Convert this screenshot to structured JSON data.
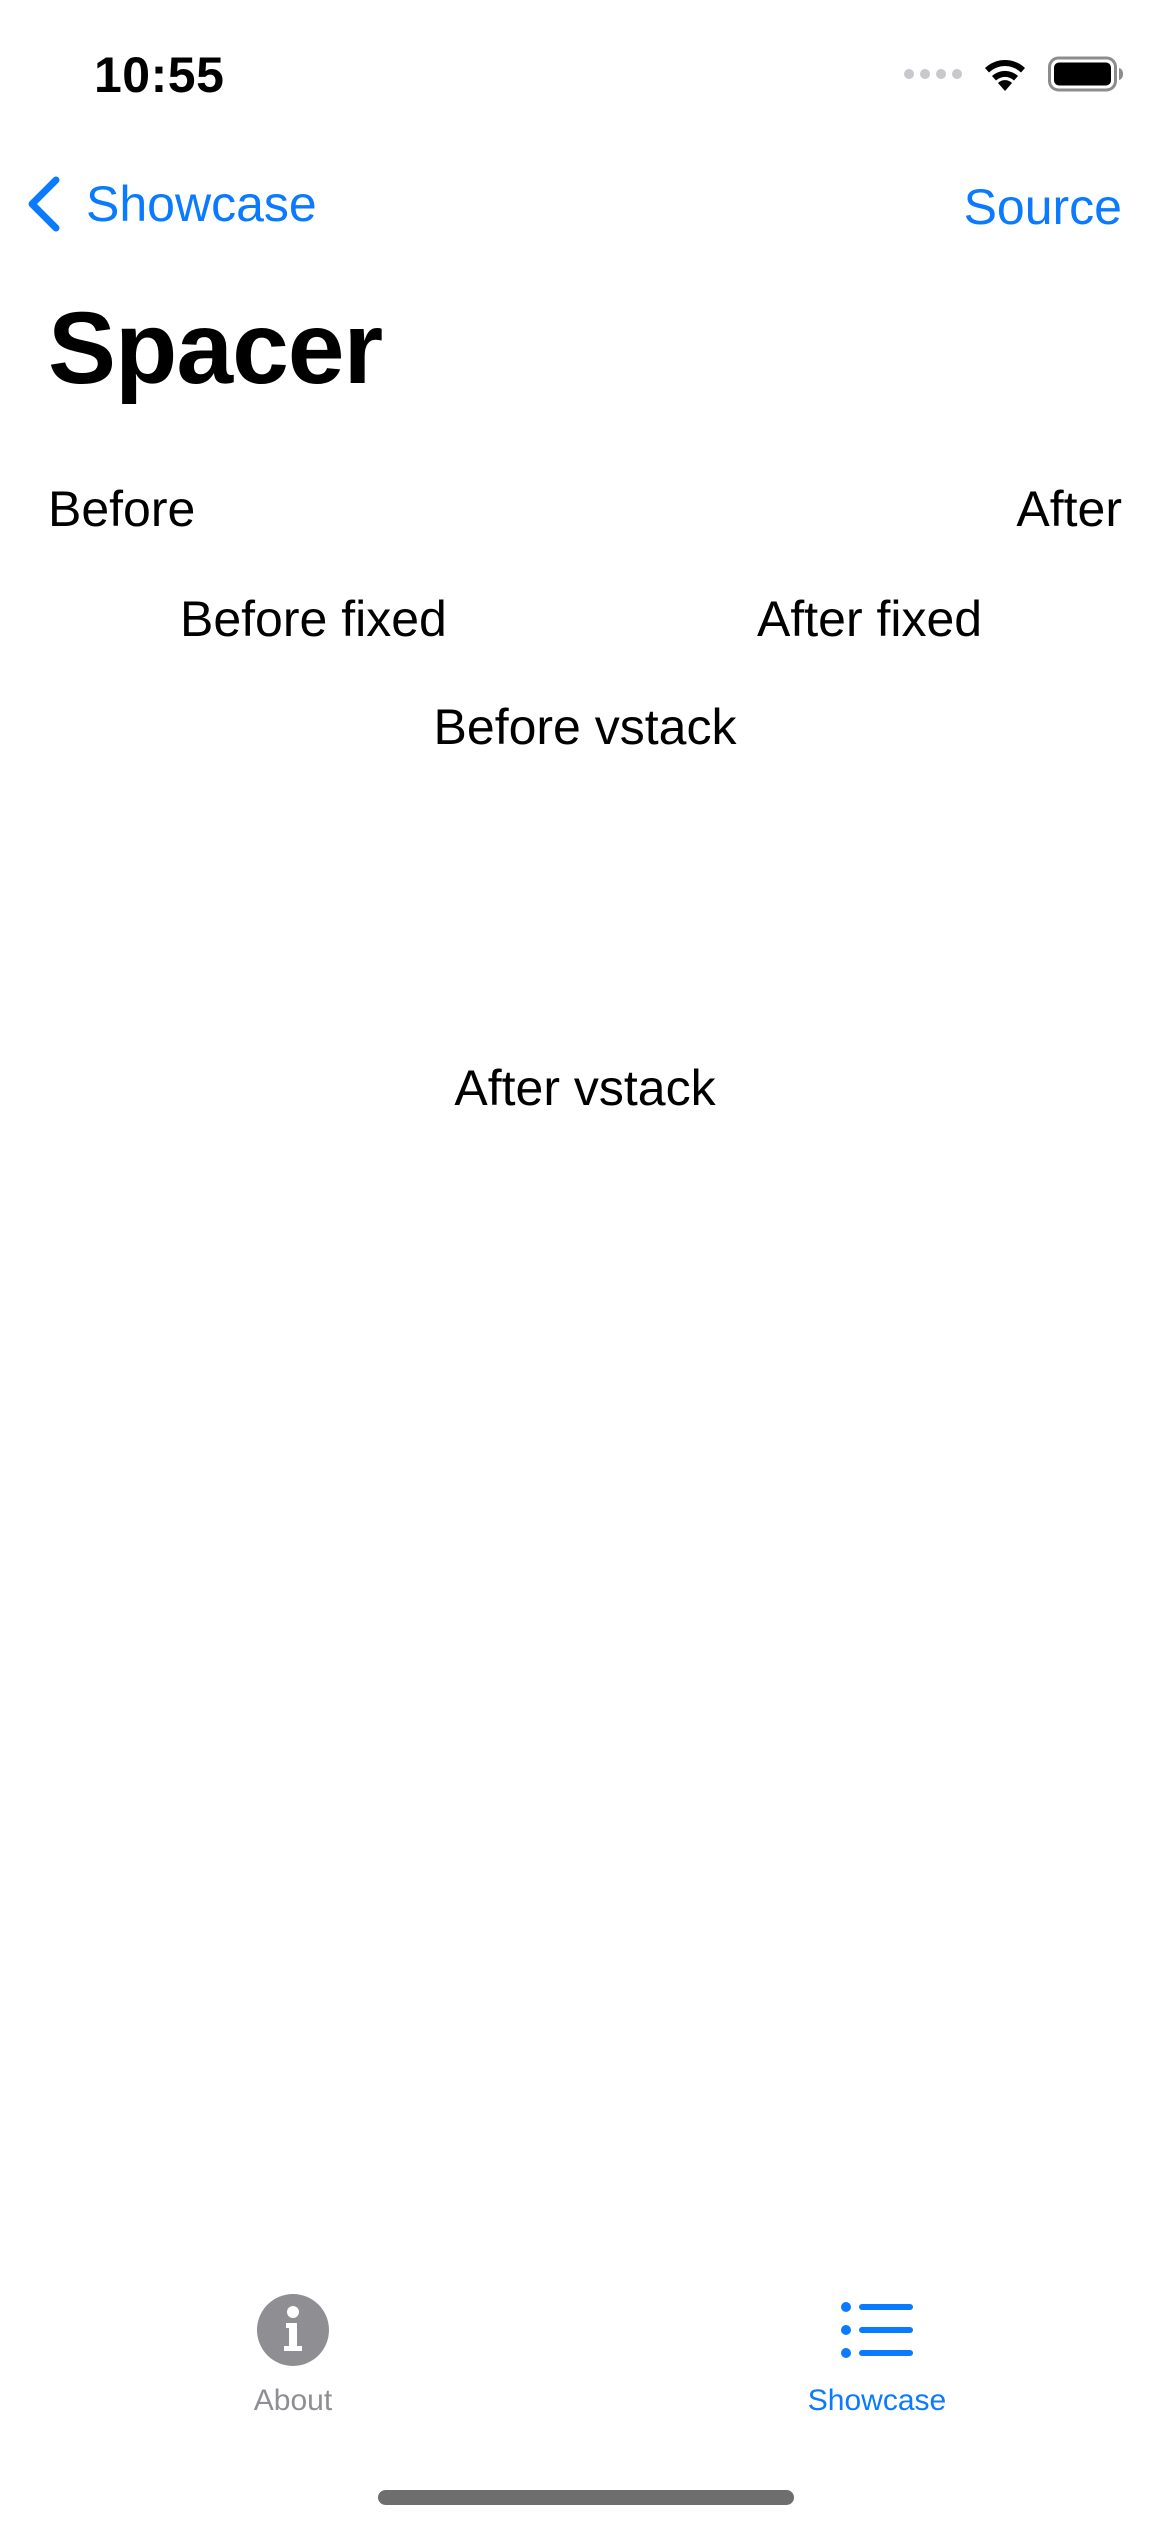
{
  "status_bar": {
    "time": "10:55",
    "icons": [
      "signal-dots-icon",
      "wifi-icon",
      "battery-icon"
    ]
  },
  "nav": {
    "back_label": "Showcase",
    "back_icon": "chevron-left-icon",
    "source_label": "Source",
    "title": "Spacer"
  },
  "content": {
    "before": "Before",
    "after": "After",
    "before_fixed": "Before fixed",
    "after_fixed": "After fixed",
    "before_vstack": "Before vstack",
    "after_vstack": "After vstack"
  },
  "tabs": [
    {
      "label": "About",
      "icon": "info-circle-icon",
      "selected": false
    },
    {
      "label": "Showcase",
      "icon": "list-bullet-icon",
      "selected": true
    }
  ],
  "colors": {
    "accent": "#0a7aff",
    "inactive_tab": "#8e8e93",
    "background": "#ffffff"
  }
}
